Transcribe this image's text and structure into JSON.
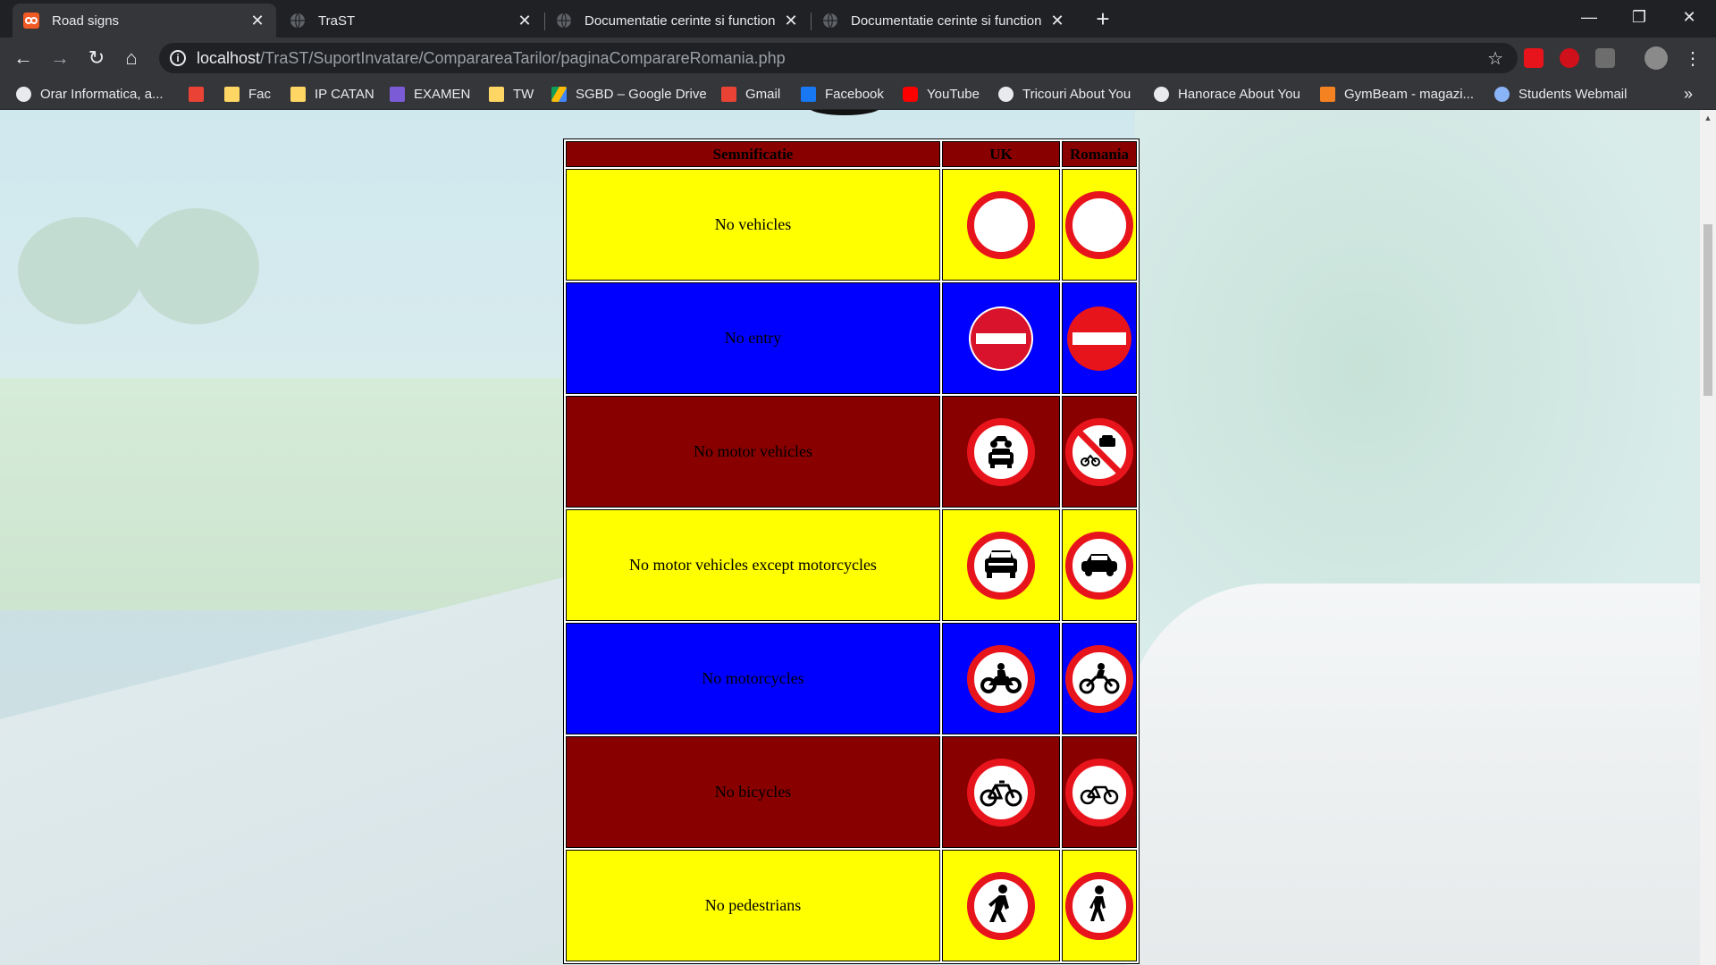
{
  "browser": {
    "tabs": [
      {
        "title": "Road signs",
        "active": true
      },
      {
        "title": "TraST",
        "active": false
      },
      {
        "title": "Documentatie cerinte si function",
        "active": false
      },
      {
        "title": "Documentatie cerinte si function",
        "active": false
      }
    ],
    "url_host": "localhost",
    "url_path": "/TraST/SuportInvatare/ComparareaTarilor/paginaComparareRomania.php",
    "bookmarks": [
      {
        "label": "Orar Informatica, a..."
      },
      {
        "label": ""
      },
      {
        "label": "Fac"
      },
      {
        "label": "IP CATAN"
      },
      {
        "label": "EXAMEN"
      },
      {
        "label": "TW"
      },
      {
        "label": "SGBD – Google Drive"
      },
      {
        "label": "Gmail"
      },
      {
        "label": "Facebook"
      },
      {
        "label": "YouTube"
      },
      {
        "label": "Tricouri About You"
      },
      {
        "label": "Hanorace About You"
      },
      {
        "label": "GymBeam - magazi..."
      },
      {
        "label": "Students Webmail"
      }
    ],
    "more_bookmarks": "»"
  },
  "table": {
    "headers": [
      "Semnificatie",
      "UK",
      "Romania"
    ],
    "rows": [
      {
        "meaning": "No vehicles",
        "bg": "#ffff00",
        "uk_icon": "no-vehicles-icon",
        "ro_icon": "no-vehicles-icon"
      },
      {
        "meaning": "No entry",
        "bg": "#0000ff",
        "uk_icon": "no-entry-icon",
        "ro_icon": "no-entry-icon"
      },
      {
        "meaning": "No motor vehicles",
        "bg": "#880000",
        "uk_icon": "no-motor-vehicles-icon",
        "ro_icon": "no-motor-vehicles-icon"
      },
      {
        "meaning": "No motor vehicles except motorcycles",
        "bg": "#ffff00",
        "uk_icon": "car-icon",
        "ro_icon": "car-icon"
      },
      {
        "meaning": "No motorcycles",
        "bg": "#0000ff",
        "uk_icon": "motorcycle-icon",
        "ro_icon": "motorcycle-icon"
      },
      {
        "meaning": "No bicycles",
        "bg": "#880000",
        "uk_icon": "bicycle-icon",
        "ro_icon": "bicycle-icon"
      },
      {
        "meaning": "No pedestrians",
        "bg": "#ffff00",
        "uk_icon": "pedestrian-icon",
        "ro_icon": "pedestrian-icon"
      }
    ]
  },
  "colors": {
    "sign_red": "#e8141c",
    "header_bg": "#880000",
    "yellow": "#ffff00",
    "blue": "#0000ff",
    "maroon": "#880000"
  }
}
